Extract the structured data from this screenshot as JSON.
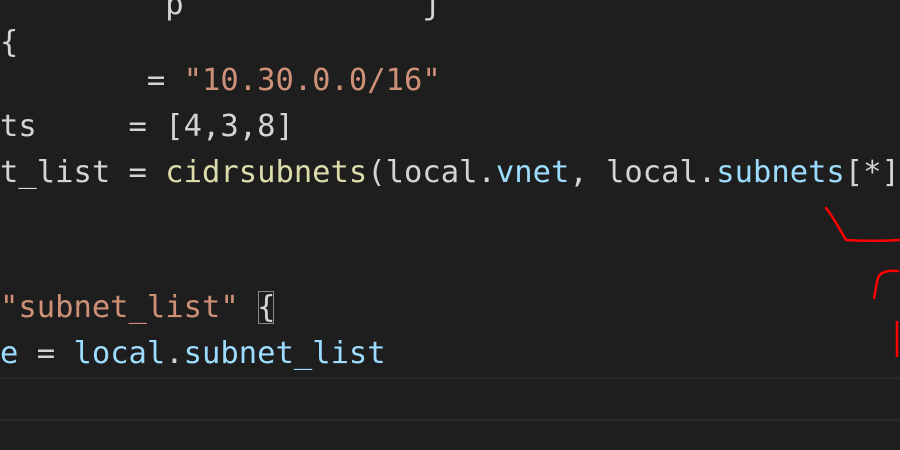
{
  "editor": {
    "line0": {
      "text": "         p             j"
    },
    "line1": {
      "brace": "{"
    },
    "line2": {
      "indent": "        ",
      "op": "= ",
      "value": "\"10.30.0.0/16\""
    },
    "line3": {
      "name": "ts",
      "op": "     = ",
      "value": "[4,3,8]"
    },
    "line4": {
      "name": "t_list",
      "op": " = ",
      "func": "cidrsubnets",
      "open": "(",
      "arg1_obj": "local",
      "arg1_dot": ".",
      "arg1_prop": "vnet",
      "sep": ", ",
      "arg2_obj": "local",
      "arg2_dot": ".",
      "arg2_prop": "subnets",
      "index": "[*]",
      "close": ")"
    },
    "line6": {
      "label": "\"subnet_list\"",
      "space": " ",
      "brace": "{"
    },
    "line7": {
      "name": "e",
      "op": " = ",
      "ref_obj": "local",
      "ref_dot": ".",
      "ref_prop": "subnet_list"
    }
  },
  "colors": {
    "background": "#1e1e1e",
    "string": "#ce9178",
    "function": "#dcdcaa",
    "identifier": "#9cdcfe",
    "text": "#d4d4d4",
    "annotation": "#ff0000"
  }
}
